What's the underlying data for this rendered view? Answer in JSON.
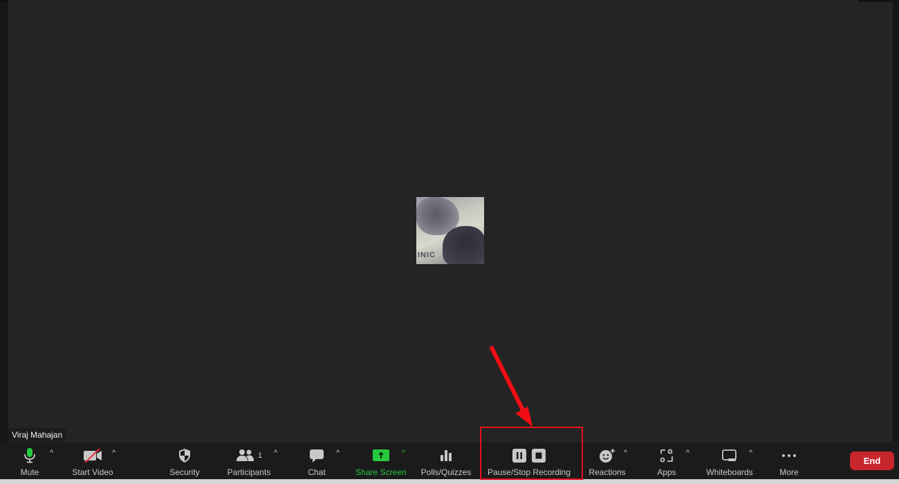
{
  "participant": {
    "name": "Viraj Mahajan",
    "avatar_text": "INIC"
  },
  "toolbar": {
    "mute_label": "Mute",
    "start_video_label": "Start Video",
    "security_label": "Security",
    "participants_label": "Participants",
    "participants_count": "1",
    "chat_label": "Chat",
    "share_screen_label": "Share Screen",
    "polls_label": "Polls/Quizzes",
    "recording_label": "Pause/Stop Recording",
    "reactions_label": "Reactions",
    "apps_label": "Apps",
    "whiteboards_label": "Whiteboards",
    "more_label": "More",
    "end_label": "End",
    "caret_glyph": "^"
  },
  "colors": {
    "accent_green": "#27c93f",
    "end_red": "#c8262d",
    "annotation_red": "#e8101f",
    "stage_bg": "#242424",
    "toolbar_bg": "#1b1b1b"
  },
  "annotation": {
    "highlight_target": "Pause/Stop Recording",
    "arrow": true
  }
}
